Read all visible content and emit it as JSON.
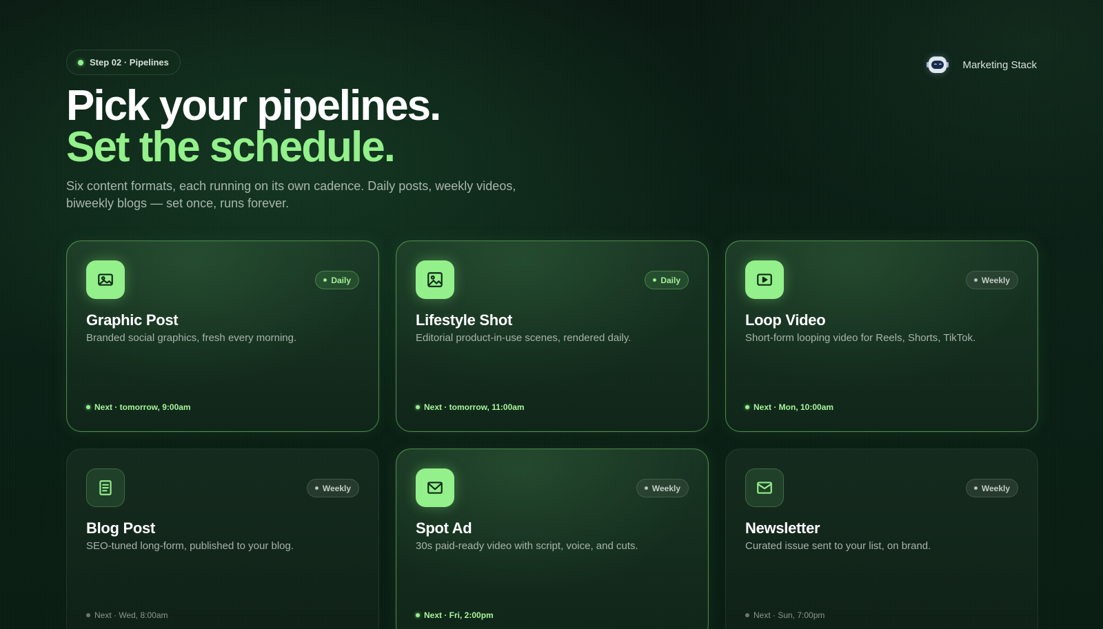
{
  "step_pill": {
    "label": "Step 02 · Pipelines"
  },
  "brand": {
    "name": "Marketing Stack",
    "logo_icon": "robot-icon"
  },
  "hero": {
    "line1": "Pick your pipelines.",
    "line2": "Set the schedule.",
    "subtitle": "Six content formats, each running on its own cadence. Daily posts, weekly videos, biweekly blogs — set once, runs forever."
  },
  "colors": {
    "accent": "#93f08a",
    "background": "#0b2116",
    "text": "#ffffff",
    "muted_text": "#a7b4ab"
  },
  "pipelines": [
    {
      "title": "Graphic Post",
      "description": "Branded social graphics, fresh every morning.",
      "frequency": "Daily",
      "next": "Next · tomorrow, 9:00am",
      "icon": "image-icon",
      "selected": true
    },
    {
      "title": "Lifestyle Shot",
      "description": "Editorial product-in-use scenes, rendered daily.",
      "frequency": "Daily",
      "next": "Next · tomorrow, 11:00am",
      "icon": "photo-icon",
      "selected": true
    },
    {
      "title": "Loop Video",
      "description": "Short-form looping video for Reels, Shorts, TikTok.",
      "frequency": "Weekly",
      "next": "Next · Mon, 10:00am",
      "icon": "play-icon",
      "selected": true
    },
    {
      "title": "Blog Post",
      "description": "SEO-tuned long-form, published to your blog.",
      "frequency": "Weekly",
      "next": "Next · Wed, 8:00am",
      "icon": "document-icon",
      "selected": false
    },
    {
      "title": "Spot Ad",
      "description": "30s paid-ready video with script, voice, and cuts.",
      "frequency": "Weekly",
      "next": "Next · Fri, 2:00pm",
      "icon": "ad-envelope-icon",
      "selected": true
    },
    {
      "title": "Newsletter",
      "description": "Curated issue sent to your list, on brand.",
      "frequency": "Weekly",
      "next": "Next · Sun, 7:00pm",
      "icon": "mail-icon",
      "selected": false
    }
  ]
}
